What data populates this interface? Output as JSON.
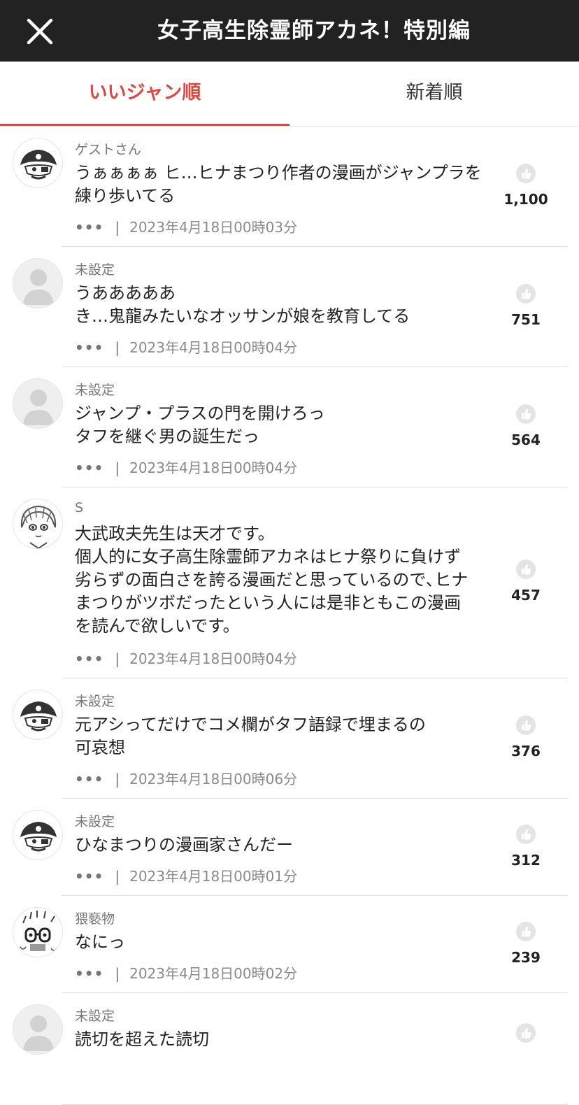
{
  "header": {
    "title": "女子高生除霊師アカネ！特別編",
    "close_icon": "close-icon"
  },
  "tabs": [
    {
      "label": "いいジャン順",
      "active": true
    },
    {
      "label": "新着順",
      "active": false
    }
  ],
  "colors": {
    "accent": "#d84a44",
    "header_bg": "#222222"
  },
  "comments": [
    {
      "user": "ゲストさん",
      "avatar": "pirate-avatar",
      "text": "うぁぁぁぁ ヒ…ヒナまつり作者の漫画がジャンプラを\n練り歩いてる",
      "more": "•••",
      "time": "2023年4月18日00時03分",
      "likes": "1,100"
    },
    {
      "user": "未設定",
      "avatar": "default-avatar",
      "text": "うあああああ\nき…鬼龍みたいなオッサンが娘を教育してる",
      "more": "•••",
      "time": "2023年4月18日00時04分",
      "likes": "751"
    },
    {
      "user": "未設定",
      "avatar": "default-avatar",
      "text": "ジャンプ・プラスの門を開けろっ\nタフを継ぐ男の誕生だっ",
      "more": "•••",
      "time": "2023年4月18日00時04分",
      "likes": "564"
    },
    {
      "user": "S",
      "avatar": "manga-girl-avatar",
      "text": "大武政夫先生は天才です。\n個人的に女子高生除霊師アカネはヒナ祭りに負けず\n劣らずの面白さを誇る漫画だと思っているので､ヒナ\nまつりがツボだったという人には是非ともこの漫画\nを読んで欲しいです。",
      "more": "•••",
      "time": "2023年4月18日00時04分",
      "likes": "457"
    },
    {
      "user": "未設定",
      "avatar": "pirate-avatar",
      "text": "元アシってだけでコメ欄がタフ語録で埋まるの\n可哀想",
      "more": "•••",
      "time": "2023年4月18日00時06分",
      "likes": "376"
    },
    {
      "user": "未設定",
      "avatar": "pirate-avatar",
      "text": "ひなまつりの漫画家さんだー",
      "more": "•••",
      "time": "2023年4月18日00時01分",
      "likes": "312"
    },
    {
      "user": "猥褻物",
      "avatar": "glasses-character-avatar",
      "text": "なにっ",
      "more": "•••",
      "time": "2023年4月18日00時02分",
      "likes": "239"
    },
    {
      "user": "未設定",
      "avatar": "default-avatar",
      "text": "読切を超えた読切",
      "more": "",
      "time": "",
      "likes": ""
    }
  ]
}
